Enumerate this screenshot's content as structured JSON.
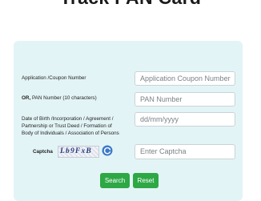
{
  "page": {
    "title": "Track PAN Card"
  },
  "form": {
    "application": {
      "label": "Application /Coupon Number",
      "placeholder": "Application Coupon Number"
    },
    "pan": {
      "label_prefix": "OR,",
      "label": " PAN Number (10 characters)",
      "placeholder": "PAN Number"
    },
    "dob": {
      "label_lines": [
        "Date of Birth /Incorporation / Agreement /",
        "Partnership or Trust Deed / Formation of",
        "Body of Individuals / Association of Persons"
      ],
      "placeholder": "dd/mm/yyyy"
    },
    "captcha": {
      "label": "Captcha",
      "image_text": "Lb9FxB",
      "refresh_icon": "refresh-icon",
      "placeholder": "Enter Captcha"
    },
    "buttons": {
      "search": "Search",
      "reset": "Reset"
    }
  },
  "colors": {
    "panel_bg": "#e3f4f6",
    "button_green": "#2da845",
    "captcha_text": "#243a7a",
    "refresh_blue": "#3b79c9"
  }
}
